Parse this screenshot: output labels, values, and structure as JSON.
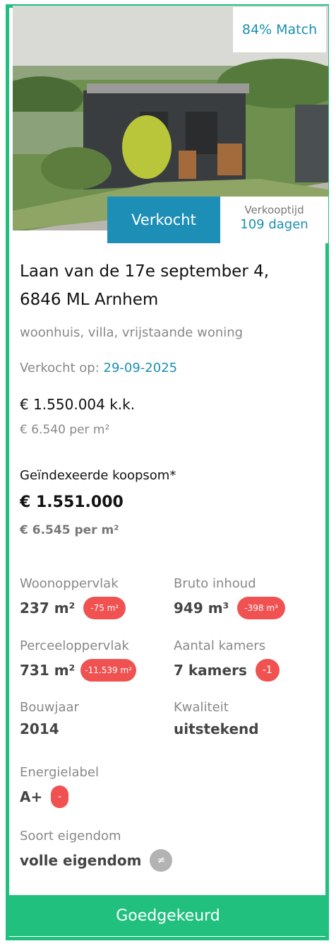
{
  "listing": {
    "match": "84% Match",
    "status": "Verkocht",
    "sell_time_label": "Verkooptijd",
    "sell_time_value": "109 dagen",
    "address_line1": "Laan van de 17e september 4,",
    "address_line2": "6846 ML Arnhem",
    "types": "woonhuis, villa, vrijstaande woning",
    "sold_on_label": "Verkocht op: ",
    "sold_on_date": "29-09-2025",
    "price": "€ 1.550.004 k.k.",
    "price_per_m2": "€ 6.540 per m²",
    "indexed_label": "Geïndexeerde koopsom*",
    "indexed_price": "€ 1.551.000",
    "indexed_price_per_m2": "€ 6.545 per m²"
  },
  "features": {
    "living_area": {
      "label": "Woonoppervlak",
      "value": "237 m²",
      "diff": "-75 m²"
    },
    "volume": {
      "label": "Bruto inhoud",
      "value": "949 m³",
      "diff": "-398 m³"
    },
    "plot": {
      "label": "Perceeloppervlak",
      "value": "731 m²",
      "diff": "-11.539 m²"
    },
    "rooms": {
      "label": "Aantal kamers",
      "value": "7 kamers",
      "diff": "-1"
    },
    "year": {
      "label": "Bouwjaar",
      "value": "2014"
    },
    "quality": {
      "label": "Kwaliteit",
      "value": "uitstekend"
    },
    "energy": {
      "label": "Energielabel",
      "value": "A+",
      "diff": "-"
    },
    "ownership": {
      "label": "Soort eigendom",
      "value": "volle eigendom",
      "diff": "≠"
    }
  },
  "actions": {
    "approved": "Goedgekeurd"
  },
  "colors": {
    "accent": "#21c07f",
    "blue": "#1d8fb6",
    "diff_red": "#f05252",
    "diff_grey": "#b3b3b3"
  }
}
